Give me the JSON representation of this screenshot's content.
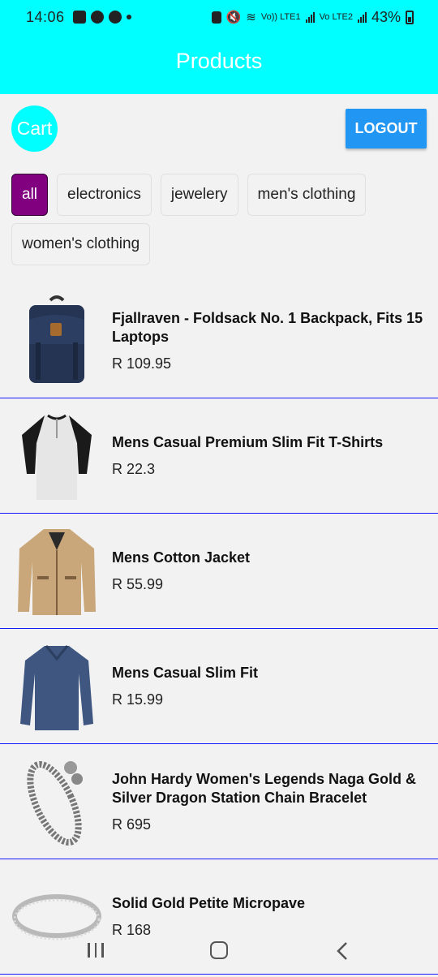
{
  "status_bar": {
    "time": "14:06",
    "network_label_1": "Vo)) LTE1",
    "network_label_2": "Vo LTE2",
    "battery_percent": "43%"
  },
  "header": {
    "title": "Products"
  },
  "toolbar": {
    "cart_label": "Cart",
    "logout_label": "LOGOUT"
  },
  "categories": [
    {
      "label": "all",
      "selected": true
    },
    {
      "label": "electronics",
      "selected": false
    },
    {
      "label": "jewelery",
      "selected": false
    },
    {
      "label": "men's clothing",
      "selected": false
    },
    {
      "label": "women's clothing",
      "selected": false
    }
  ],
  "products": [
    {
      "title": "Fjallraven - Foldsack No. 1 Backpack, Fits 15 Laptops",
      "price": "R 109.95",
      "image": "backpack"
    },
    {
      "title": "Mens Casual Premium Slim Fit T-Shirts",
      "price": "R 22.3",
      "image": "raglan-shirt"
    },
    {
      "title": "Mens Cotton Jacket",
      "price": "R 55.99",
      "image": "jacket"
    },
    {
      "title": "Mens Casual Slim Fit",
      "price": "R 15.99",
      "image": "long-sleeve-shirt"
    },
    {
      "title": "John Hardy Women's Legends Naga Gold & Silver Dragon Station Chain Bracelet",
      "price": "R 695",
      "image": "bracelet"
    },
    {
      "title": "Solid Gold Petite Micropave",
      "price": "R 168",
      "image": "ring"
    }
  ],
  "colors": {
    "header_bg": "#00ffff",
    "logout_bg": "#2196f3",
    "chip_selected_bg": "#800080",
    "divider": "#1a1aff"
  }
}
